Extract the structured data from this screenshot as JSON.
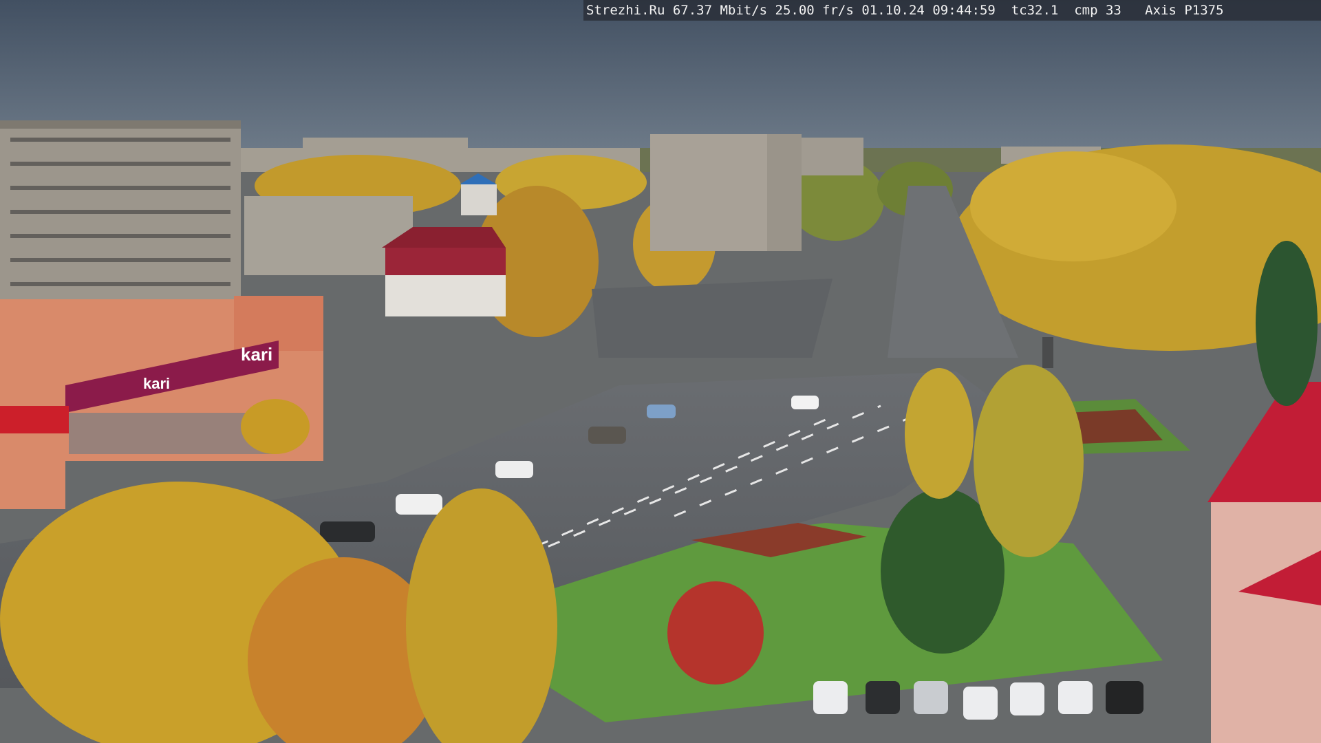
{
  "overlay": {
    "text": "Strezhi.Ru 67.37 Mbit/s 25.00 fr/s 01.10.24 09:44:59  tc32.1  cmp 33   Axis P1375"
  },
  "signage": {
    "store_sign": "kari",
    "store_facade": "kari"
  },
  "colors": {
    "sky": "#4e5b6b",
    "asphalt": "#5c5f63",
    "grass": "#5f9a3e",
    "autumn_tree": "#c9a02a",
    "store_red": "#8b1b4a",
    "roof_red": "#c21d36"
  }
}
